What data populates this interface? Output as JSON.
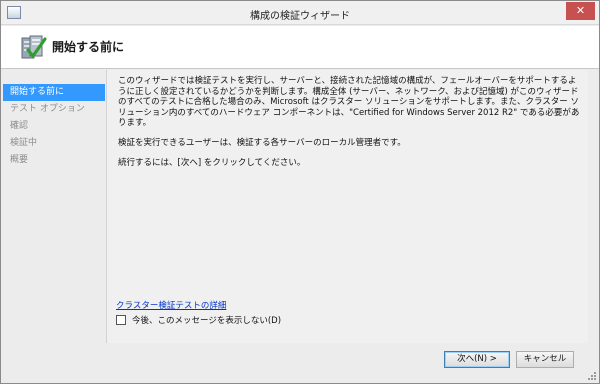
{
  "window": {
    "title": "構成の検証ウィザード",
    "close_label": "✕"
  },
  "header": {
    "title": "開始する前に",
    "icon": "validate-checkmark-icon"
  },
  "sidebar": {
    "items": [
      {
        "label": "開始する前に",
        "active": true
      },
      {
        "label": "テスト オプション",
        "active": false
      },
      {
        "label": "確認",
        "active": false
      },
      {
        "label": "検証中",
        "active": false
      },
      {
        "label": "概要",
        "active": false
      }
    ]
  },
  "content": {
    "paragraph1": "このウィザードでは検証テストを実行し、サーバーと、接続された記憶域の構成が、フェールオーバーをサポートするように正しく設定されているかどうかを判断します。構成全体 (サーバー、ネットワーク、および記憶域) がこのウィザードのすべてのテストに合格した場合のみ、Microsoft はクラスター ソリューションをサポートします。また、クラスター ソリューション内のすべてのハードウェア コンポーネントは、\"Certified for Windows Server 2012 R2\" である必要があります。",
    "paragraph2": "検証を実行できるユーザーは、検証する各サーバーのローカル管理者です。",
    "paragraph3": "続行するには、[次へ] をクリックしてください。",
    "details_link": "クラスター検証テストの詳細",
    "checkbox_label": "今後、このメッセージを表示しない(D)",
    "checkbox_checked": false
  },
  "footer": {
    "next_label": "次へ(N) >",
    "cancel_label": "キャンセル"
  },
  "colors": {
    "accent": "#3399ff",
    "link": "#0033cc",
    "close": "#c75050"
  }
}
